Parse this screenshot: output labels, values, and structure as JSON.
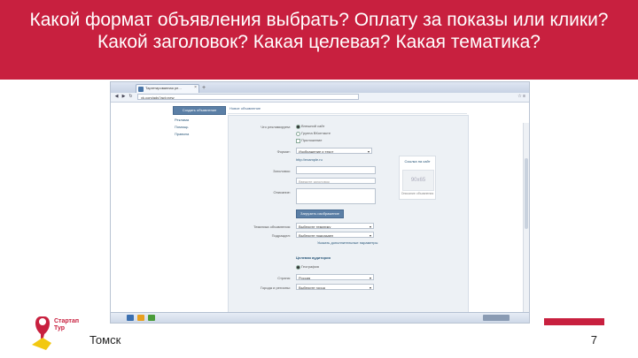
{
  "slide": {
    "title": "Какой формат объявления выбрать? Оплату за показы или клики? Какой заголовок? Какая целевая? Какая тематика?",
    "footer_city": "Томск",
    "page_number": "7",
    "logo_text": "Стартап Тур",
    "accent_color": "#c8203f"
  },
  "browser": {
    "tab_label": "Таргетированная ре...",
    "tab_close": "×",
    "new_tab": "+",
    "url": "vk.com/ads?act=new",
    "back_icon": "back-arrow-icon",
    "forward_icon": "forward-arrow-icon",
    "reload_icon": "reload-icon"
  },
  "vk_page": {
    "create_button": "Создать объявление",
    "left_links": [
      "Рекламa",
      "Помощь",
      "Правила"
    ],
    "breadcrumb": "Новое объявление",
    "form": {
      "what_label": "Что рекламируем:",
      "options": [
        "Внешний сайт",
        "Группа ВКонтакте",
        "Приложение"
      ],
      "url_label": "Ссылка:",
      "url_value": "http://example.ru",
      "format_label": "Формат:",
      "format_value": "Изображение и текст",
      "title_label": "Заголовок:",
      "title_placeholder": "Введите заголовок",
      "desc_label": "Описание:",
      "upload_button": "Загрузить изображение",
      "topic_label": "Тематика объявления:",
      "topic_value": "Выберите тематику",
      "subtopic_label": "Подраздел:",
      "subtopic_value": "Выберите подраздел",
      "more_link": "Указать дополнительные параметры",
      "audience_heading": "Целевая аудитория",
      "audience_option": "География",
      "country_label": "Страна:",
      "country_value": "Россия",
      "city_label": "Города и регионы:",
      "city_value": "Выберите город"
    },
    "preview": {
      "title": "Ссылка на сайт",
      "image_text": "90х65",
      "caption": "Описание объявления"
    }
  }
}
